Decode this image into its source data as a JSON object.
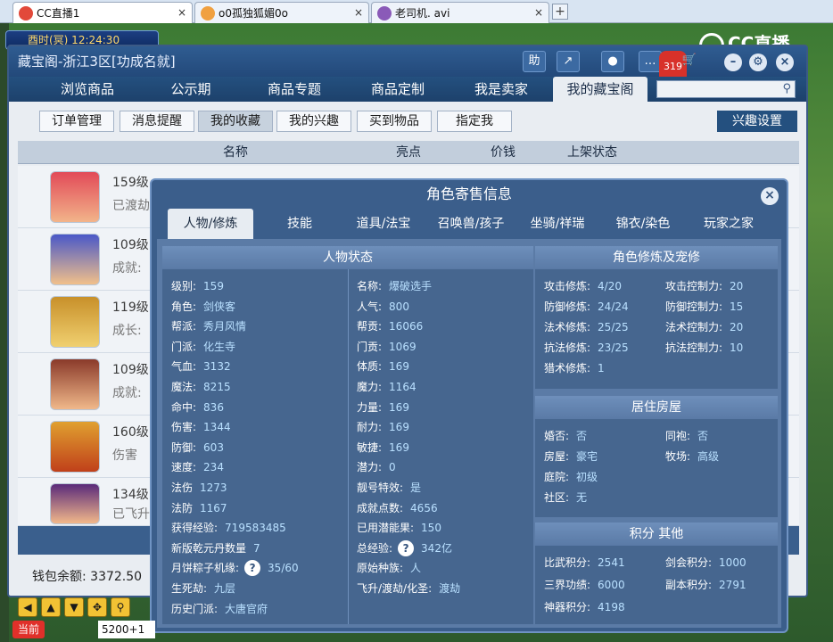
{
  "browser_tabs": [
    {
      "label": "CC直播1",
      "active": true
    },
    {
      "label": "o0孤独狐媚0o",
      "active": false
    },
    {
      "label": "老司机. avi",
      "active": false
    }
  ],
  "game": {
    "clock": "酉时(冥) 12:24:30",
    "logo": "CC直播",
    "bottom": {
      "current_label": "当前",
      "chat_value": "5200+1"
    }
  },
  "cbg": {
    "title": "藏宝阁-浙江3区[功成名就]",
    "toolbar": {
      "help": "助",
      "message_count": "319"
    },
    "nav": [
      "浏览商品",
      "公示期",
      "商品专题",
      "商品定制",
      "我是卖家",
      "我的藏宝阁"
    ],
    "subnav": [
      "订单管理",
      "消息提醒",
      "我的收藏",
      "我的兴趣",
      "买到物品",
      "指定我"
    ],
    "interest_settings": "兴趣设置",
    "list_headers": [
      "名称",
      "亮点",
      "价钱",
      "上架状态"
    ],
    "rows": [
      {
        "level": "159级",
        "sub": "已渡劫"
      },
      {
        "level": "109级",
        "sub": "成就:"
      },
      {
        "level": "119级",
        "sub": "成长:"
      },
      {
        "level": "109级",
        "sub": "成就:"
      },
      {
        "level": "160级",
        "sub": "伤害"
      },
      {
        "level": "134级",
        "sub": "已飞升"
      }
    ],
    "wallet": "钱包余额: 3372.50"
  },
  "popup": {
    "title": "角色寄售信息",
    "tabs": [
      "人物/修炼",
      "技能",
      "道具/法宝",
      "召唤兽/孩子",
      "坐骑/祥瑞",
      "锦衣/染色",
      "玩家之家"
    ],
    "status": {
      "header": "人物状态",
      "left": [
        {
          "k": "级别:",
          "v": "159"
        },
        {
          "k": "角色:",
          "v": "剑侠客"
        },
        {
          "k": "帮派:",
          "v": "秀月风情"
        },
        {
          "k": "门派:",
          "v": "化生寺"
        },
        {
          "k": "气血:",
          "v": "3132"
        },
        {
          "k": "魔法:",
          "v": "8215"
        },
        {
          "k": "命中:",
          "v": "836"
        },
        {
          "k": "伤害:",
          "v": "1344"
        },
        {
          "k": "防御:",
          "v": "603"
        },
        {
          "k": "速度:",
          "v": "234"
        },
        {
          "k": "法伤",
          "v": "1273"
        },
        {
          "k": "法防",
          "v": "1167"
        },
        {
          "k": "获得经验:",
          "v": "719583485"
        },
        {
          "k": "新版乾元丹数量",
          "v": "7"
        },
        {
          "k": "月饼粽子机缘:",
          "v": "35/60"
        },
        {
          "k": "生死劫:",
          "v": "九层"
        },
        {
          "k": "历史门派:",
          "v": "大唐官府"
        }
      ],
      "right": [
        {
          "k": "名称:",
          "v": "爆破选手"
        },
        {
          "k": "人气:",
          "v": "800"
        },
        {
          "k": "帮贡:",
          "v": "16066"
        },
        {
          "k": "门贡:",
          "v": "1069"
        },
        {
          "k": "体质:",
          "v": "169"
        },
        {
          "k": "魔力:",
          "v": "1164"
        },
        {
          "k": "力量:",
          "v": "169"
        },
        {
          "k": "耐力:",
          "v": "169"
        },
        {
          "k": "敏捷:",
          "v": "169"
        },
        {
          "k": "潜力:",
          "v": "0"
        },
        {
          "k": "靓号特效:",
          "v": "是"
        },
        {
          "k": "成就点数:",
          "v": "4656"
        },
        {
          "k": "已用潜能果:",
          "v": "150"
        },
        {
          "k": "总经验:",
          "v": "342亿"
        },
        {
          "k": "原始种族:",
          "v": "人"
        },
        {
          "k": "飞升/渡劫/化圣:",
          "v": "渡劫"
        }
      ]
    },
    "practice": {
      "header": "角色修炼及宠修",
      "left": [
        {
          "k": "攻击修炼:",
          "v": "4/20"
        },
        {
          "k": "防御修炼:",
          "v": "24/24"
        },
        {
          "k": "法术修炼:",
          "v": "25/25"
        },
        {
          "k": "抗法修炼:",
          "v": "23/25"
        },
        {
          "k": "猎术修炼:",
          "v": "1"
        }
      ],
      "right": [
        {
          "k": "攻击控制力:",
          "v": "20"
        },
        {
          "k": "防御控制力:",
          "v": "15"
        },
        {
          "k": "法术控制力:",
          "v": "20"
        },
        {
          "k": "抗法控制力:",
          "v": "10"
        }
      ]
    },
    "housing": {
      "header": "居住房屋",
      "left": [
        {
          "k": "婚否:",
          "v": "否"
        },
        {
          "k": "房屋:",
          "v": "豪宅"
        },
        {
          "k": "庭院:",
          "v": "初级"
        },
        {
          "k": "社区:",
          "v": "无"
        }
      ],
      "right": [
        {
          "k": "同袍:",
          "v": "否"
        },
        {
          "k": "牧场:",
          "v": "高级"
        }
      ]
    },
    "points": {
      "header": "积分 其他",
      "left": [
        {
          "k": "比武积分:",
          "v": "2541"
        },
        {
          "k": "三界功绩:",
          "v": "6000"
        },
        {
          "k": "神器积分:",
          "v": "4198"
        }
      ],
      "right": [
        {
          "k": "剑会积分:",
          "v": "1000"
        },
        {
          "k": "副本积分:",
          "v": "2791"
        }
      ]
    }
  }
}
